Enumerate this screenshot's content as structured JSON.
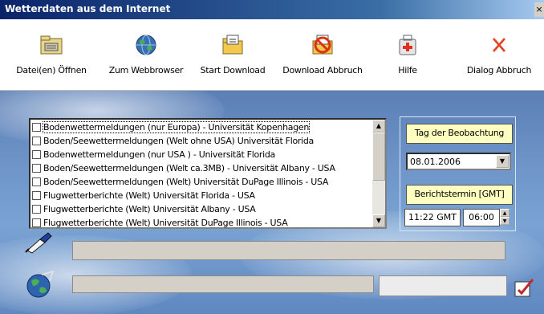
{
  "window": {
    "title": "Wetterdaten aus dem Internet",
    "close_label": "×"
  },
  "toolbar": {
    "open_label": "Datei(en) Öffnen",
    "browser_label": "Zum Webbrowser",
    "start_label": "Start Download",
    "abort_download_label": "Download Abbruch",
    "help_label": "Hilfe",
    "dialog_abort_label": "Dialog Abbruch"
  },
  "sources": {
    "items": [
      {
        "label": "Bodenwettermeldungen (nur Europa) - Universität Kopenhagen",
        "checked": false
      },
      {
        "label": "Boden/Seewettermeldungen (Welt ohne USA) Universität Florida",
        "checked": false
      },
      {
        "label": "Bodenwettermeldungen (nur USA ) - Universität Florida",
        "checked": false
      },
      {
        "label": "Boden/Seewettermeldungen (Welt ca.3MB) - Universität Albany - USA",
        "checked": false
      },
      {
        "label": "Boden/Seewettermeldungen (Welt) Universität DuPage Illinois - USA",
        "checked": false
      },
      {
        "label": "Flugwetterberichte  (Welt) Universität Florida - USA",
        "checked": false
      },
      {
        "label": "Flugwetterberichte (Welt) Universität Albany - USA",
        "checked": false
      },
      {
        "label": "Flugwetterberichte (Welt) Universität DuPage Illinois - USA",
        "checked": false
      }
    ]
  },
  "settings": {
    "date_button": "Tag der Beobachtung",
    "date_value": "08.01.2006",
    "report_time_button": "Berichtstermin [GMT]",
    "current_time": "11:22 GMT",
    "report_hour": "06:00"
  },
  "colors": {
    "button_yellow": "#ffffc0",
    "sky": "#6f95c9",
    "titlebar": "#0a246a"
  },
  "icons": {
    "open": "folder-open-icon",
    "browser": "globe-icon",
    "start": "download-folder-icon",
    "abort": "cancel-download-icon",
    "help": "first-aid-kit-icon",
    "dialog_abort": "close-x-icon",
    "pen": "pen-icon",
    "globe_status": "globe-arrow-icon",
    "edit": "edit-checkbox-icon"
  }
}
